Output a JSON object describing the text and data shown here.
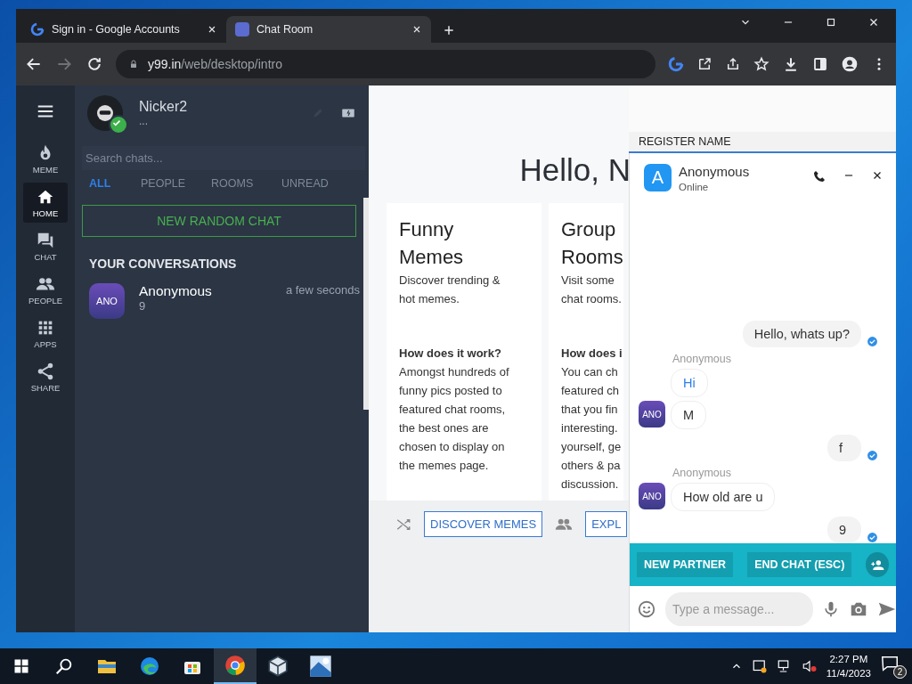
{
  "browser": {
    "tabs": [
      {
        "title": "Sign in - Google Accounts",
        "selected": false
      },
      {
        "title": "Chat Room",
        "selected": true
      }
    ],
    "forward_disabled": true,
    "address": {
      "host": "y99.in",
      "path": "/web/desktop/intro"
    }
  },
  "nav": [
    {
      "label": "MEME",
      "selected": false
    },
    {
      "label": "HOME",
      "selected": true
    },
    {
      "label": "CHAT",
      "selected": false
    },
    {
      "label": "PEOPLE",
      "selected": false
    },
    {
      "label": "APPS",
      "selected": false
    },
    {
      "label": "SHARE",
      "selected": false
    }
  ],
  "profile": {
    "name": "Nicker2",
    "status": "...",
    "online": true
  },
  "search": {
    "placeholder": "Search chats..."
  },
  "filters": [
    {
      "label": "ALL",
      "selected": true
    },
    {
      "label": "PEOPLE",
      "selected": false
    },
    {
      "label": "ROOMS",
      "selected": false
    },
    {
      "label": "UNREAD",
      "selected": false
    }
  ],
  "new_chat_button": "NEW RANDOM CHAT",
  "conversations_title": "YOUR CONVERSATIONS",
  "conversations": [
    {
      "initials": "ANO",
      "name": "Anonymous",
      "preview": "9",
      "time": "a few seconds"
    }
  ],
  "intro": {
    "greeting": "Hello, N",
    "cards": [
      {
        "title_lines": [
          "Funny",
          "Memes"
        ],
        "description_lines": [
          "Discover trending &",
          "hot memes."
        ],
        "question": "How does it work?",
        "body_lines": [
          "Amongst hundreds of",
          "funny pics posted to",
          "featured chat rooms,",
          "the best ones are",
          "chosen to display on",
          "the memes page."
        ],
        "button": "DISCOVER MEMES"
      },
      {
        "title_lines": [
          "Group",
          "Rooms"
        ],
        "description_lines": [
          "Visit some",
          "chat rooms."
        ],
        "question": "How does i",
        "body_lines": [
          "You can ch",
          "featured ch",
          "that you fin",
          "interesting.",
          "yourself, ge",
          "others & pa",
          "discussion."
        ],
        "button": "EXPL"
      }
    ]
  },
  "register_bar": "REGISTER NAME",
  "chat": {
    "avatar_letter": "A",
    "name": "Anonymous",
    "status": "Online",
    "messages": [
      {
        "kind": "sent",
        "text": "Hello, whats up?",
        "read": true
      },
      {
        "kind": "received",
        "sender": "Anonymous",
        "initials": "ANO",
        "bubbles": [
          {
            "text": "Hi",
            "highlighted": true
          },
          {
            "text": "M",
            "highlighted": false
          }
        ]
      },
      {
        "kind": "sent",
        "text": "f",
        "read": true
      },
      {
        "kind": "received",
        "sender": "Anonymous",
        "initials": "ANO",
        "bubbles": [
          {
            "text": "How old are u",
            "highlighted": false
          }
        ]
      },
      {
        "kind": "sent",
        "text": "9",
        "read": true
      }
    ],
    "actions": [
      "NEW PARTNER",
      "END CHAT (ESC)"
    ],
    "composer": {
      "placeholder": "Type a message..."
    }
  },
  "taskbar": {
    "apps": [
      {
        "selected": false
      },
      {
        "selected": false
      },
      {
        "selected": false
      },
      {
        "selected": true
      },
      {
        "selected": false
      },
      {
        "selected": false
      }
    ],
    "time": "2:27 PM",
    "date": "11/4/2023",
    "notifications": "2"
  }
}
